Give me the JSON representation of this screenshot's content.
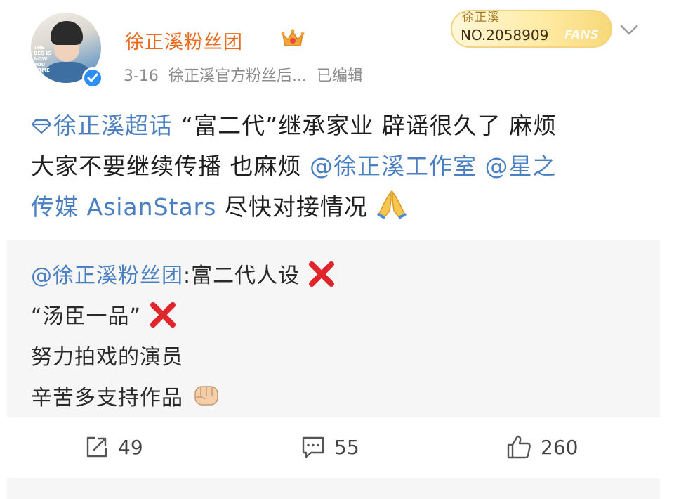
{
  "user": {
    "name": "徐正溪粉丝团",
    "date": "3-16",
    "source": "徐正溪官方粉丝后...",
    "edited": "已编辑",
    "avatar_text": "THE BES IS NOW YOU COME"
  },
  "fan_badge": {
    "name": "徐正溪",
    "number": "NO.2058909",
    "tag": "FANS"
  },
  "post": {
    "topic": "徐正溪超话",
    "line1_rest": "“富二代”继承家业 辟谣很久了 麻烦",
    "line2_start": "大家不要继续传播  也麻烦 ",
    "mention1": "@徐正溪工作室",
    "mention2_start": " @星之",
    "line3_link": "传媒 AsianStars",
    "line3_rest": " 尽快对接情况"
  },
  "repost": {
    "mention": "@徐正溪粉丝团",
    "line1_rest": ":富二代人设",
    "line2": "“汤臣一品”",
    "line3": "努力拍戏的演员",
    "line4": "辛苦多支持作品"
  },
  "actions": {
    "share_count": "49",
    "comment_count": "55",
    "like_count": "260"
  },
  "colors": {
    "username": "#e86b1f",
    "link": "#4a7fc1",
    "verified": "#2d8ef5",
    "cross": "#e0262a"
  },
  "icons": [
    "topic-icon",
    "crown-icon",
    "verified-icon",
    "chevron-down-icon",
    "praying-hands-emoji",
    "cross-mark-emoji",
    "fist-emoji",
    "share-icon",
    "comment-icon",
    "like-icon"
  ]
}
